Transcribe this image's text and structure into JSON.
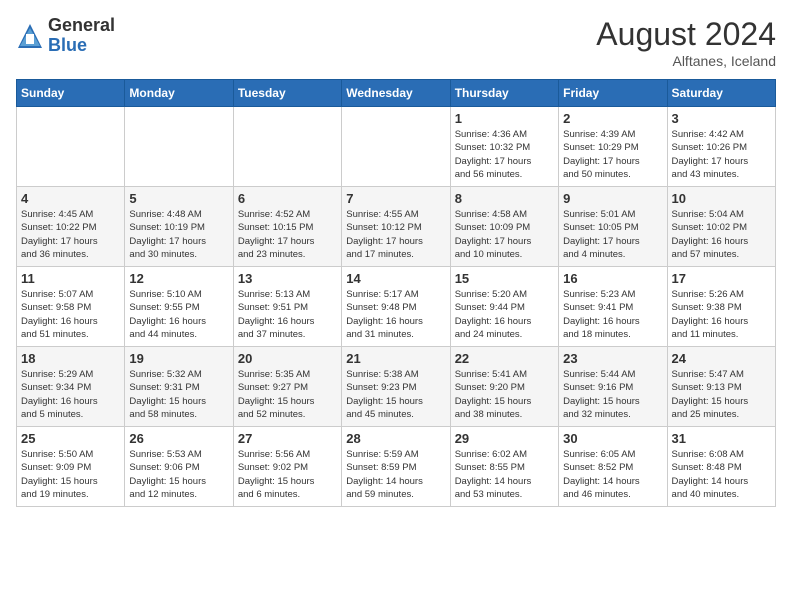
{
  "header": {
    "logo_general": "General",
    "logo_blue": "Blue",
    "month_year": "August 2024",
    "location": "Alftanes, Iceland"
  },
  "days_of_week": [
    "Sunday",
    "Monday",
    "Tuesday",
    "Wednesday",
    "Thursday",
    "Friday",
    "Saturday"
  ],
  "weeks": [
    [
      {
        "day": "",
        "info": ""
      },
      {
        "day": "",
        "info": ""
      },
      {
        "day": "",
        "info": ""
      },
      {
        "day": "",
        "info": ""
      },
      {
        "day": "1",
        "info": "Sunrise: 4:36 AM\nSunset: 10:32 PM\nDaylight: 17 hours\nand 56 minutes."
      },
      {
        "day": "2",
        "info": "Sunrise: 4:39 AM\nSunset: 10:29 PM\nDaylight: 17 hours\nand 50 minutes."
      },
      {
        "day": "3",
        "info": "Sunrise: 4:42 AM\nSunset: 10:26 PM\nDaylight: 17 hours\nand 43 minutes."
      }
    ],
    [
      {
        "day": "4",
        "info": "Sunrise: 4:45 AM\nSunset: 10:22 PM\nDaylight: 17 hours\nand 36 minutes."
      },
      {
        "day": "5",
        "info": "Sunrise: 4:48 AM\nSunset: 10:19 PM\nDaylight: 17 hours\nand 30 minutes."
      },
      {
        "day": "6",
        "info": "Sunrise: 4:52 AM\nSunset: 10:15 PM\nDaylight: 17 hours\nand 23 minutes."
      },
      {
        "day": "7",
        "info": "Sunrise: 4:55 AM\nSunset: 10:12 PM\nDaylight: 17 hours\nand 17 minutes."
      },
      {
        "day": "8",
        "info": "Sunrise: 4:58 AM\nSunset: 10:09 PM\nDaylight: 17 hours\nand 10 minutes."
      },
      {
        "day": "9",
        "info": "Sunrise: 5:01 AM\nSunset: 10:05 PM\nDaylight: 17 hours\nand 4 minutes."
      },
      {
        "day": "10",
        "info": "Sunrise: 5:04 AM\nSunset: 10:02 PM\nDaylight: 16 hours\nand 57 minutes."
      }
    ],
    [
      {
        "day": "11",
        "info": "Sunrise: 5:07 AM\nSunset: 9:58 PM\nDaylight: 16 hours\nand 51 minutes."
      },
      {
        "day": "12",
        "info": "Sunrise: 5:10 AM\nSunset: 9:55 PM\nDaylight: 16 hours\nand 44 minutes."
      },
      {
        "day": "13",
        "info": "Sunrise: 5:13 AM\nSunset: 9:51 PM\nDaylight: 16 hours\nand 37 minutes."
      },
      {
        "day": "14",
        "info": "Sunrise: 5:17 AM\nSunset: 9:48 PM\nDaylight: 16 hours\nand 31 minutes."
      },
      {
        "day": "15",
        "info": "Sunrise: 5:20 AM\nSunset: 9:44 PM\nDaylight: 16 hours\nand 24 minutes."
      },
      {
        "day": "16",
        "info": "Sunrise: 5:23 AM\nSunset: 9:41 PM\nDaylight: 16 hours\nand 18 minutes."
      },
      {
        "day": "17",
        "info": "Sunrise: 5:26 AM\nSunset: 9:38 PM\nDaylight: 16 hours\nand 11 minutes."
      }
    ],
    [
      {
        "day": "18",
        "info": "Sunrise: 5:29 AM\nSunset: 9:34 PM\nDaylight: 16 hours\nand 5 minutes."
      },
      {
        "day": "19",
        "info": "Sunrise: 5:32 AM\nSunset: 9:31 PM\nDaylight: 15 hours\nand 58 minutes."
      },
      {
        "day": "20",
        "info": "Sunrise: 5:35 AM\nSunset: 9:27 PM\nDaylight: 15 hours\nand 52 minutes."
      },
      {
        "day": "21",
        "info": "Sunrise: 5:38 AM\nSunset: 9:23 PM\nDaylight: 15 hours\nand 45 minutes."
      },
      {
        "day": "22",
        "info": "Sunrise: 5:41 AM\nSunset: 9:20 PM\nDaylight: 15 hours\nand 38 minutes."
      },
      {
        "day": "23",
        "info": "Sunrise: 5:44 AM\nSunset: 9:16 PM\nDaylight: 15 hours\nand 32 minutes."
      },
      {
        "day": "24",
        "info": "Sunrise: 5:47 AM\nSunset: 9:13 PM\nDaylight: 15 hours\nand 25 minutes."
      }
    ],
    [
      {
        "day": "25",
        "info": "Sunrise: 5:50 AM\nSunset: 9:09 PM\nDaylight: 15 hours\nand 19 minutes."
      },
      {
        "day": "26",
        "info": "Sunrise: 5:53 AM\nSunset: 9:06 PM\nDaylight: 15 hours\nand 12 minutes."
      },
      {
        "day": "27",
        "info": "Sunrise: 5:56 AM\nSunset: 9:02 PM\nDaylight: 15 hours\nand 6 minutes."
      },
      {
        "day": "28",
        "info": "Sunrise: 5:59 AM\nSunset: 8:59 PM\nDaylight: 14 hours\nand 59 minutes."
      },
      {
        "day": "29",
        "info": "Sunrise: 6:02 AM\nSunset: 8:55 PM\nDaylight: 14 hours\nand 53 minutes."
      },
      {
        "day": "30",
        "info": "Sunrise: 6:05 AM\nSunset: 8:52 PM\nDaylight: 14 hours\nand 46 minutes."
      },
      {
        "day": "31",
        "info": "Sunrise: 6:08 AM\nSunset: 8:48 PM\nDaylight: 14 hours\nand 40 minutes."
      }
    ]
  ]
}
